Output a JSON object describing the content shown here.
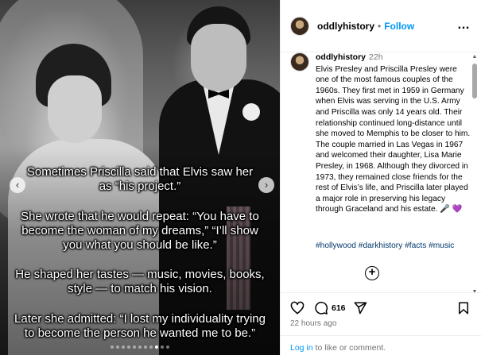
{
  "media": {
    "captions": [
      [
        "Sometimes Priscilla said that Elvis saw her",
        "as “his project.”"
      ],
      [
        "She wrote that he would repeat: “You have to",
        "become the woman of my dreams,” “I’ll show",
        "you what you should be like.”"
      ],
      [
        "He shaped her tastes — music, movies, books,",
        "style — to match his vision."
      ],
      [
        "Later she admitted: “I lost my individuality trying",
        "to become the person he wanted me to be.”"
      ]
    ],
    "slide_count": 11,
    "active_slide": 8
  },
  "header": {
    "username": "oddlyhistory",
    "separator": "•",
    "follow_label": "Follow",
    "more_label": "…"
  },
  "caption_comment": {
    "username": "oddlyhistory",
    "time": "22h",
    "text": "Elvis Presley and Priscilla Presley were one of the most famous couples of the 1960s. They first met in 1959 in Germany when Elvis was serving in the U.S. Army and Priscilla was only 14 years old. Their relationship continued long-distance until she moved to Memphis to be closer to him. The couple married in Las Vegas in 1967 and welcomed their daughter, Lisa Marie Presley, in 1968. Although they divorced in 1973, they remained close friends for the rest of Elvis’s life, and Priscilla later played a major role in preserving his legacy through Graceland and his estate.",
    "emoji": "🎤 💜",
    "hashtags": "#hollywood #darkhistory #facts #music"
  },
  "actions": {
    "comment_count": "616",
    "time_ago": "22 hours ago"
  },
  "footer": {
    "login_link": "Log in",
    "login_text": " to like or comment."
  }
}
